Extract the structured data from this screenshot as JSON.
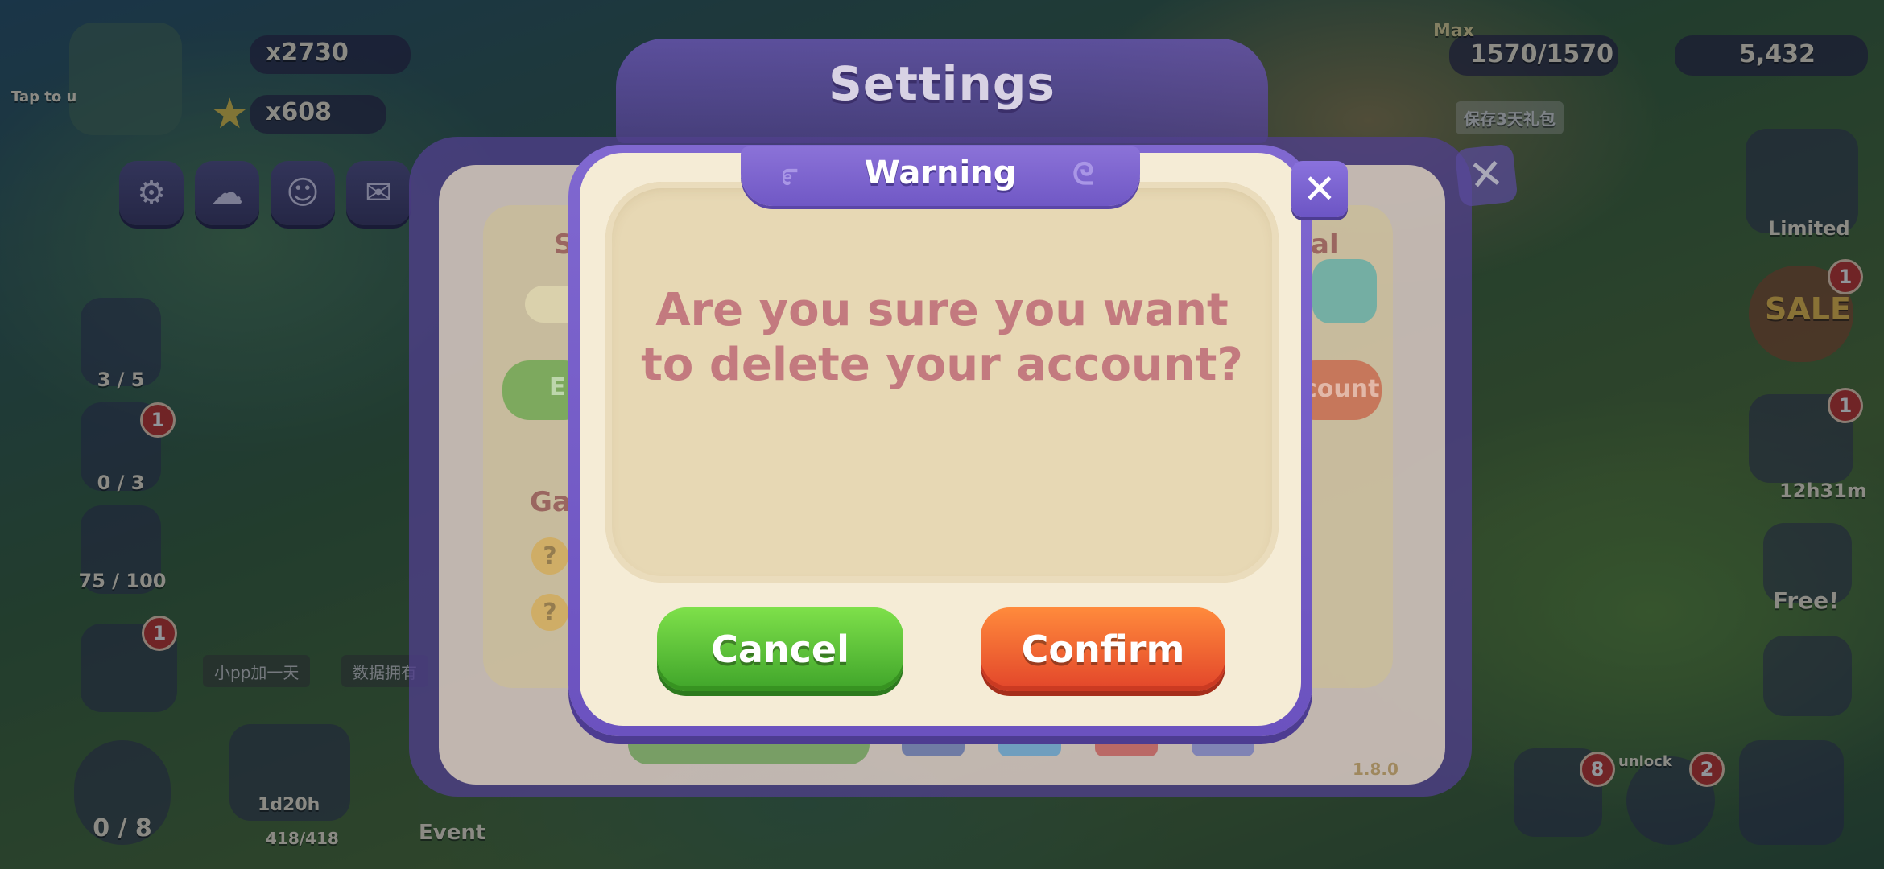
{
  "hud": {
    "coins": "x2730",
    "stars": "x608",
    "energy_label": "Max",
    "energy": "1570/1570",
    "gems": "5,432",
    "tap_hint": "Tap to u",
    "gift_banner": "保存3天礼包",
    "limited_label": "Limited",
    "sale_label": "SALE",
    "timer_sale": "12h31m",
    "free_label": "Free!",
    "quest_counts": [
      "3 / 5",
      "0 / 3",
      "75 / 100"
    ],
    "clock_count": "0 / 8",
    "build_timer": "1d20h",
    "build_progress": "418/418",
    "event_label": "Event",
    "unlock_label": "unlock",
    "cn_button_1": "小pp加一天",
    "cn_button_2": "数据拥有",
    "badges": [
      "1",
      "1",
      "1",
      "1",
      "8",
      "2"
    ]
  },
  "settings": {
    "title": "Settings",
    "partial_left_label": "S",
    "partial_right_label": "al",
    "partial_button_left": "E",
    "partial_button_right": "count",
    "partial_section": "Ga",
    "version": "1.8.0"
  },
  "dialog": {
    "title": "Warning",
    "message": "Are you sure you want to delete your account?",
    "cancel_label": "Cancel",
    "confirm_label": "Confirm"
  },
  "colors": {
    "dialog_purple": "#7058c5",
    "message_text": "#c37a7f",
    "cancel_green": "#4cb52f",
    "confirm_orange": "#e8512e"
  }
}
